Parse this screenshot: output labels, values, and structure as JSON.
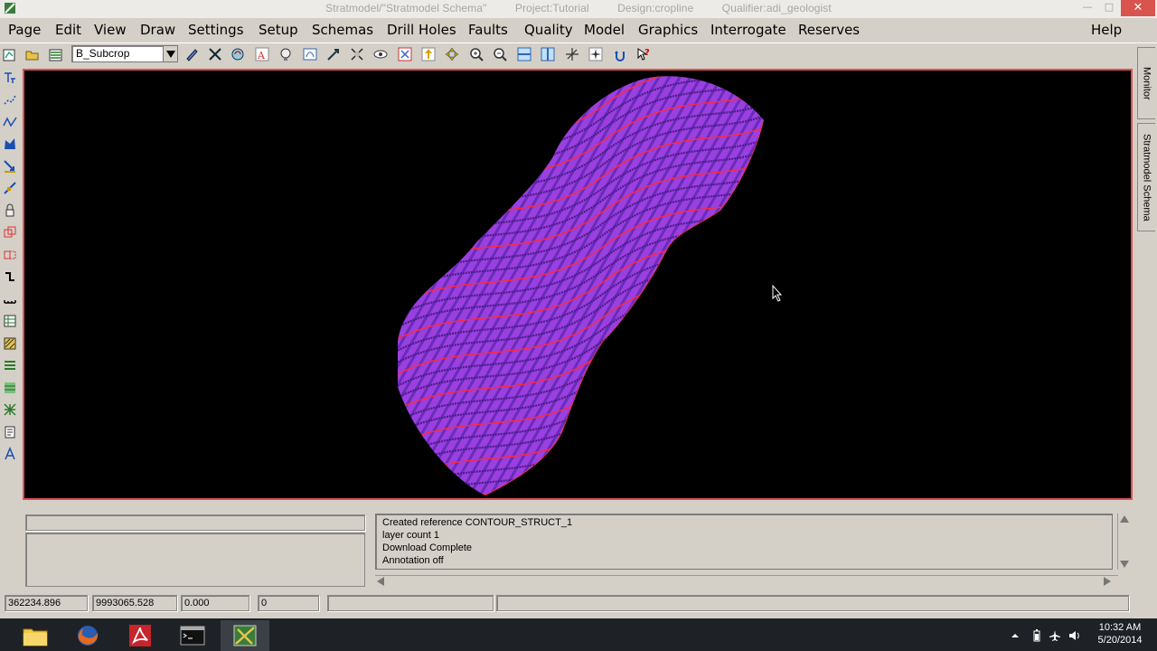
{
  "window": {
    "title_parts": [
      "Stratmodel/\"Stratmodel Schema\"",
      "Project:Tutorial",
      "Design:cropline",
      "Qualifier:adi_geologist"
    ],
    "minimize_glyph": "—",
    "maximize_glyph": "□",
    "close_glyph": "✕"
  },
  "menu": {
    "items": [
      "Page",
      "Edit",
      "View",
      "Draw",
      "Settings",
      "Setup",
      "Schemas",
      "Drill Holes",
      "Faults",
      "Quality",
      "Model",
      "Graphics",
      "Interrogate",
      "Reserves"
    ],
    "help": "Help"
  },
  "toolbar": {
    "layer_value": "B_Subcrop"
  },
  "right_tabs": {
    "monitor": "Monitor",
    "schema": "Stratmodel Schema"
  },
  "log": {
    "lines": [
      "Created reference CONTOUR_STRUCT_1",
      "layer count 1",
      "Download Complete",
      "Annotation off"
    ]
  },
  "coords": {
    "x": "362234.896",
    "y": "9993065.528",
    "z": "0.000",
    "n": "0"
  },
  "clock": {
    "time": "10:32 AM",
    "date": "5/20/2014"
  },
  "colors": {
    "surface_fill": "#9a3fe0",
    "contour_red": "#ff2a3a",
    "viewport_border": "#e0524f"
  }
}
